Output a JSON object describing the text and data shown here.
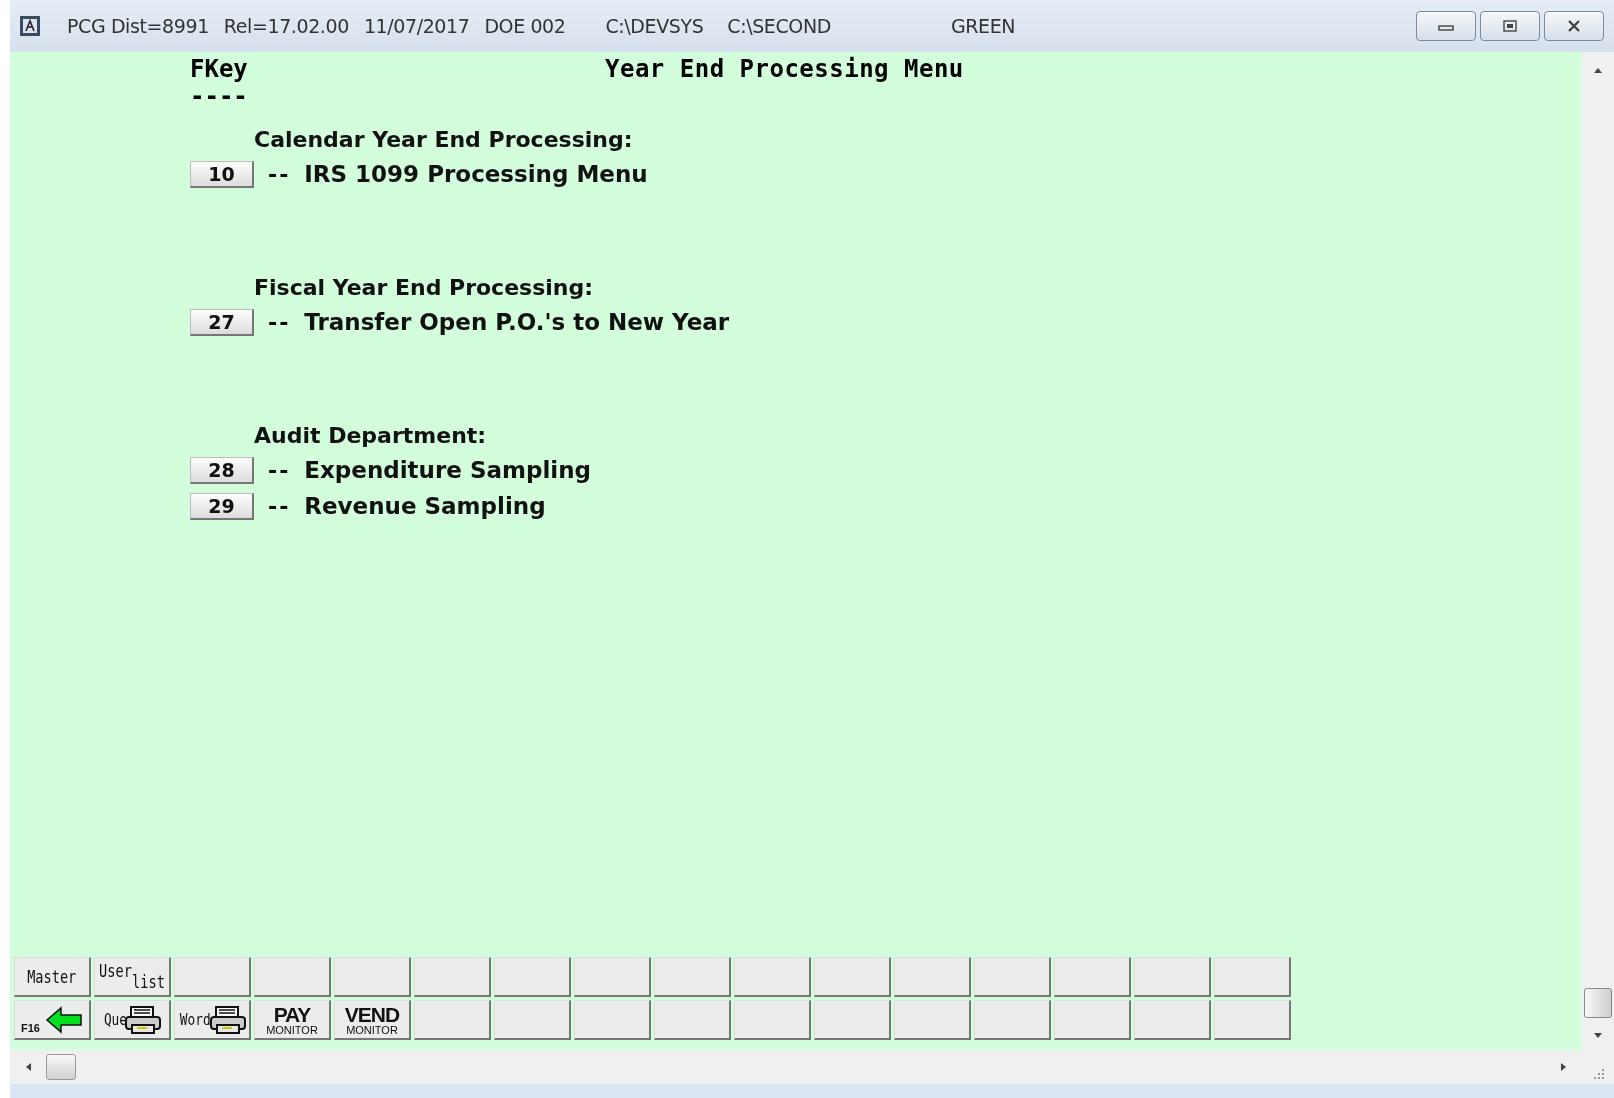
{
  "window": {
    "title_fields": [
      "PCG Dist=8991",
      "Rel=17.02.00",
      "11/07/2017",
      "DOE 002",
      "C:\\DEVSYS",
      "C:\\SECOND",
      "GREEN"
    ]
  },
  "menu": {
    "fkey_heading": "FKey",
    "fkey_rule": "----",
    "title": "Year End Processing Menu",
    "sections": [
      {
        "heading": "Calendar Year End Processing:",
        "items": [
          {
            "key": "10",
            "dashes": "--",
            "label": "IRS 1099 Processing Menu"
          }
        ]
      },
      {
        "heading": "Fiscal Year End Processing:",
        "items": [
          {
            "key": "27",
            "dashes": "--",
            "label": "Transfer Open P.O.'s to New Year"
          }
        ]
      },
      {
        "heading": "Audit Department:",
        "items": [
          {
            "key": "28",
            "dashes": "--",
            "label": "Expenditure Sampling"
          },
          {
            "key": "29",
            "dashes": "--",
            "label": "Revenue Sampling"
          }
        ]
      }
    ]
  },
  "toolbar": [
    [
      {
        "kind": "text",
        "label": "Master"
      },
      {
        "kind": "stacked",
        "top": "User",
        "bottom": "list"
      },
      {
        "kind": "blank"
      },
      {
        "kind": "blank"
      },
      {
        "kind": "blank"
      },
      {
        "kind": "blank"
      },
      {
        "kind": "blank"
      },
      {
        "kind": "blank"
      },
      {
        "kind": "blank"
      },
      {
        "kind": "blank"
      },
      {
        "kind": "blank"
      },
      {
        "kind": "blank"
      },
      {
        "kind": "blank"
      },
      {
        "kind": "blank"
      },
      {
        "kind": "blank"
      },
      {
        "kind": "blank"
      }
    ],
    [
      {
        "kind": "back",
        "label": "F16"
      },
      {
        "kind": "print",
        "label": "Que"
      },
      {
        "kind": "print",
        "label": "Word"
      },
      {
        "kind": "monitor",
        "label": "PAY",
        "sub": "MONITOR"
      },
      {
        "kind": "monitor",
        "label": "VEND",
        "sub": "MONITOR"
      },
      {
        "kind": "blank"
      },
      {
        "kind": "blank"
      },
      {
        "kind": "blank"
      },
      {
        "kind": "blank"
      },
      {
        "kind": "blank"
      },
      {
        "kind": "blank"
      },
      {
        "kind": "blank"
      },
      {
        "kind": "blank"
      },
      {
        "kind": "blank"
      },
      {
        "kind": "blank"
      },
      {
        "kind": "blank"
      }
    ]
  ]
}
